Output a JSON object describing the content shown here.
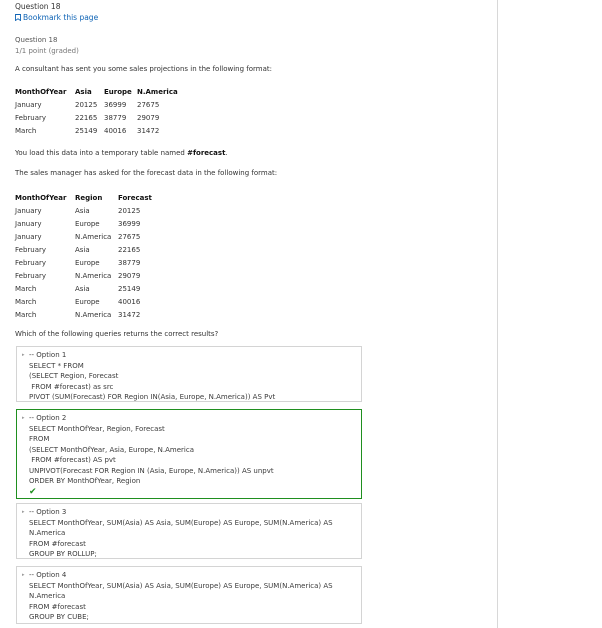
{
  "header": {
    "question_title": "Question 18",
    "bookmark_label": "Bookmark this page"
  },
  "problem": {
    "heading": "Question 18",
    "points": "1/1 point (graded)",
    "intro": "A consultant has sent you some sales projections in the following format:",
    "table1": {
      "columns": [
        "MonthOfYear",
        "Asia",
        "Europe",
        "N.America"
      ],
      "rows": [
        [
          "January",
          "20125",
          "36999",
          "27675"
        ],
        [
          "February",
          "22165",
          "38779",
          "29079"
        ],
        [
          "March",
          "25149",
          "40016",
          "31472"
        ]
      ]
    },
    "load_text_prefix": "You load this data into a temporary table named ",
    "load_text_bold": "#forecast",
    "load_text_suffix": ".",
    "request_text": "The sales manager has asked for the forecast data in the following format:",
    "table2": {
      "columns": [
        "MonthOfYear",
        "Region",
        "Forecast"
      ],
      "rows": [
        [
          "January",
          "Asia",
          "20125"
        ],
        [
          "January",
          "Europe",
          "36999"
        ],
        [
          "January",
          "N.America",
          "27675"
        ],
        [
          "February",
          "Asia",
          "22165"
        ],
        [
          "February",
          "Europe",
          "38779"
        ],
        [
          "February",
          "N.America",
          "29079"
        ],
        [
          "March",
          "Asia",
          "25149"
        ],
        [
          "March",
          "Europe",
          "40016"
        ],
        [
          "March",
          "N.America",
          "31472"
        ]
      ]
    },
    "question_text": "Which of the following queries returns the correct results?"
  },
  "options": [
    {
      "lines": [
        "-- Option 1",
        "SELECT * FROM",
        "(SELECT Region, Forecast",
        " FROM #forecast) as src",
        "PIVOT (SUM(Forecast) FOR Region IN(Asia, Europe, N.America)) AS Pvt"
      ],
      "correct": false
    },
    {
      "lines": [
        "-- Option 2",
        "SELECT MonthOfYear, Region, Forecast",
        "FROM",
        "(SELECT MonthOfYear, Asia, Europe, N.America",
        " FROM #forecast) AS pvt",
        "UNPIVOT(Forecast FOR Region IN (Asia, Europe, N.America)) AS unpvt",
        "ORDER BY MonthOfYear, Region"
      ],
      "correct": true
    },
    {
      "lines": [
        "-- Option 3",
        "SELECT MonthOfYear, SUM(Asia) AS Asia, SUM(Europe) AS Europe, SUM(N.America) AS",
        "N.America",
        "FROM #forecast",
        "GROUP BY ROLLUP;"
      ],
      "correct": false
    },
    {
      "lines": [
        "-- Option 4",
        "SELECT MonthOfYear, SUM(Asia) AS Asia, SUM(Europe) AS Europe, SUM(N.America) AS",
        "N.America",
        "FROM #forecast",
        "GROUP BY CUBE;"
      ],
      "correct": false
    }
  ],
  "colors": {
    "link": "#0e63b5",
    "correct": "#1f8f1f",
    "border": "#d4d4d4"
  },
  "icons": {
    "bookmark": "bookmark-icon",
    "check": "check-icon",
    "radio": "radio-icon"
  }
}
